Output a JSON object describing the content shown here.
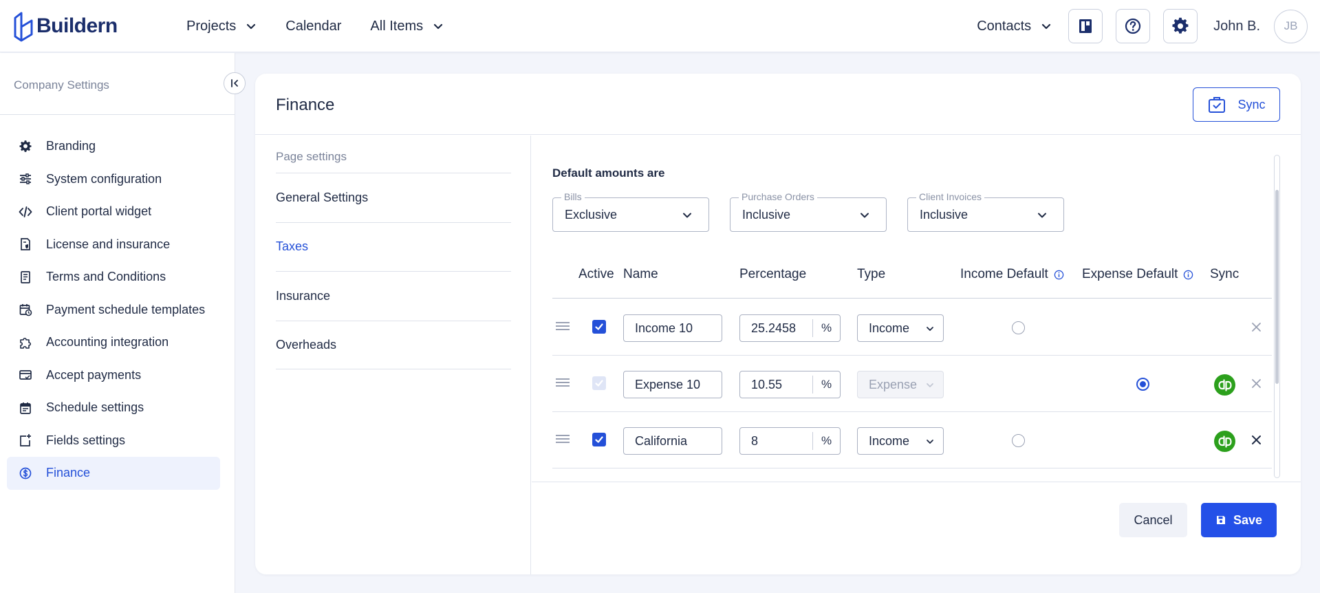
{
  "app": {
    "logo_text": "Buildern"
  },
  "nav": [
    {
      "label": "Projects",
      "has_dropdown": true
    },
    {
      "label": "Calendar",
      "has_dropdown": false
    },
    {
      "label": "All Items",
      "has_dropdown": true
    }
  ],
  "top_right": {
    "contacts_label": "Contacts",
    "user_name": "John B.",
    "avatar_initials": "JB"
  },
  "sidebar": {
    "title": "Company Settings",
    "items": [
      {
        "label": "Branding",
        "icon": "gear-icon"
      },
      {
        "label": "System configuration",
        "icon": "sliders-icon"
      },
      {
        "label": "Client portal widget",
        "icon": "code-icon"
      },
      {
        "label": "License and insurance",
        "icon": "document-shield-icon"
      },
      {
        "label": "Terms and Conditions",
        "icon": "document-icon"
      },
      {
        "label": "Payment schedule templates",
        "icon": "calendar-clock-icon"
      },
      {
        "label": "Accounting integration",
        "icon": "puzzle-icon"
      },
      {
        "label": "Accept payments",
        "icon": "card-icon"
      },
      {
        "label": "Schedule settings",
        "icon": "calendar-icon"
      },
      {
        "label": "Fields settings",
        "icon": "add-field-icon"
      },
      {
        "label": "Finance",
        "icon": "dollar-circle-icon",
        "active": true
      }
    ]
  },
  "card": {
    "title": "Finance",
    "sync_label": "Sync"
  },
  "subnav": {
    "title": "Page settings",
    "items": [
      {
        "label": "General Settings"
      },
      {
        "label": "Taxes",
        "active": true
      },
      {
        "label": "Insurance"
      },
      {
        "label": "Overheads"
      }
    ]
  },
  "defaults": {
    "heading": "Default amounts are",
    "bills": {
      "label": "Bills",
      "value": "Exclusive"
    },
    "purchase_orders": {
      "label": "Purchase Orders",
      "value": "Inclusive"
    },
    "client_invoices": {
      "label": "Client Invoices",
      "value": "Inclusive"
    }
  },
  "table": {
    "headers": {
      "active": "Active",
      "name": "Name",
      "percentage": "Percentage",
      "type": "Type",
      "income_default": "Income Default",
      "expense_default": "Expense Default",
      "sync": "Sync"
    },
    "rows": [
      {
        "active": true,
        "active_disabled": false,
        "name": "Income 10",
        "percentage": "25.2458",
        "unit": "%",
        "type": "Income",
        "type_disabled": false,
        "default_column": "income",
        "default_checked": false,
        "synced": false
      },
      {
        "active": true,
        "active_disabled": true,
        "name": "Expense 10",
        "percentage": "10.55",
        "unit": "%",
        "type": "Expense",
        "type_disabled": true,
        "default_column": "expense",
        "default_checked": true,
        "synced": true
      },
      {
        "active": true,
        "active_disabled": false,
        "name": "California",
        "percentage": "8",
        "unit": "%",
        "type": "Income",
        "type_disabled": false,
        "default_column": "income",
        "default_checked": false,
        "synced": true
      }
    ]
  },
  "footer": {
    "cancel_label": "Cancel",
    "save_label": "Save"
  },
  "colors": {
    "accent": "#2450d8",
    "quickbooks": "#2ca01c",
    "brand": "#1b2e6b"
  }
}
